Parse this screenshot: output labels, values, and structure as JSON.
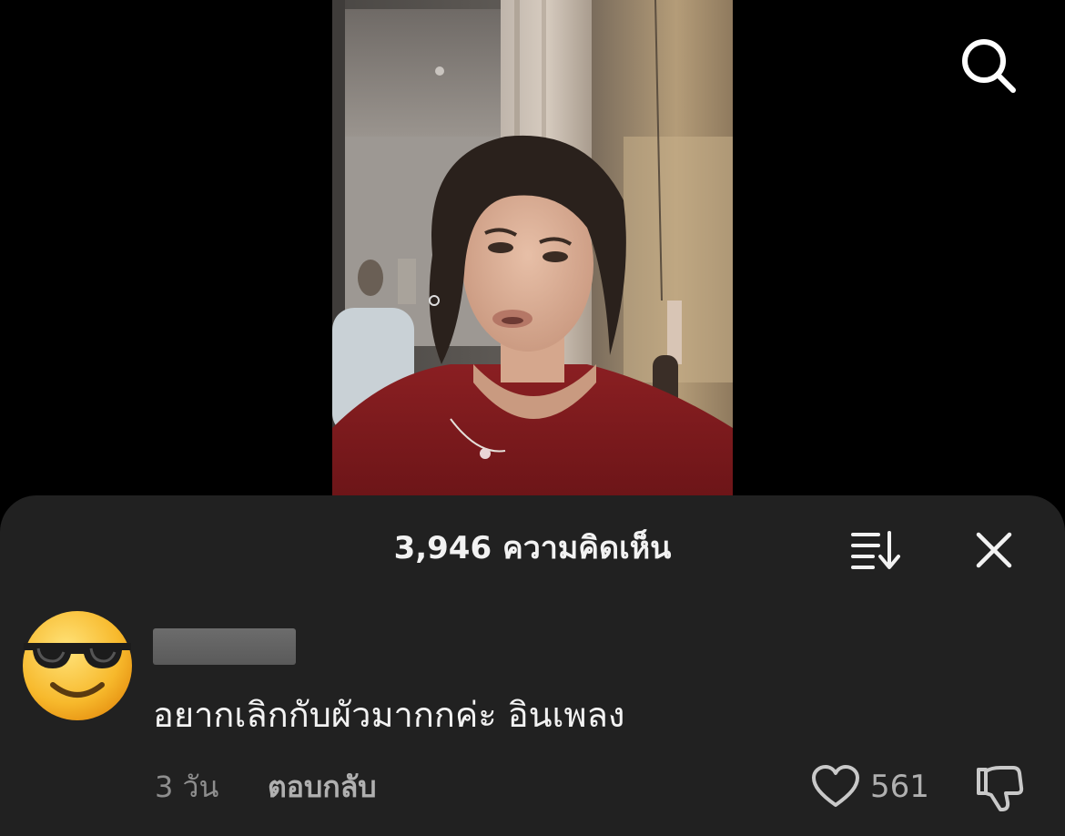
{
  "header": {
    "search_icon": "search-icon"
  },
  "comments_panel": {
    "title": "3,946 ความคิดเห็น",
    "sort_icon": "sort-icon",
    "close_icon": "close-icon"
  },
  "comment": {
    "avatar_icon": "sunglasses-emoji-avatar",
    "text": "อยากเลิกกับผัวมากกค่ะ อินเพลง",
    "time": "3 วัน",
    "reply_label": "ตอบกลับ",
    "like_count": "561",
    "like_icon": "heart-icon",
    "dislike_icon": "thumbs-down-icon"
  },
  "colors": {
    "background": "#000000",
    "sheet": "#212121",
    "text_primary": "#f2f2f2",
    "text_secondary": "#8e8e8e"
  }
}
